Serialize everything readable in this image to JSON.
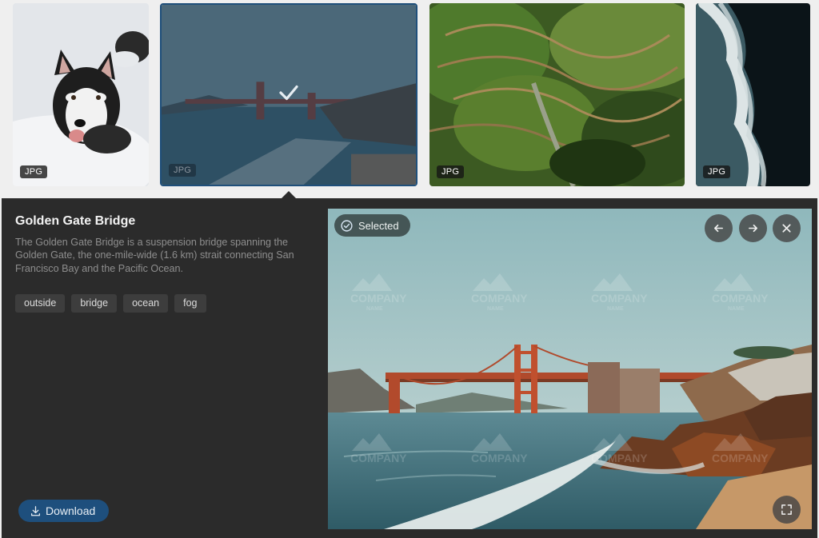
{
  "thumbnails": [
    {
      "badge": "JPG",
      "alt": "husky"
    },
    {
      "badge": "JPG",
      "alt": "golden-gate",
      "selected": true
    },
    {
      "badge": "JPG",
      "alt": "rice-terraces"
    },
    {
      "badge": "JPG",
      "alt": "ocean-waves"
    }
  ],
  "detail": {
    "title": "Golden Gate Bridge",
    "description": "The Golden Gate Bridge is a suspension bridge spanning the Golden Gate, the one-mile-wide (1.6 km) strait connecting San Francisco Bay and the Pacific Ocean.",
    "tags": [
      "outside",
      "bridge",
      "ocean",
      "fog"
    ],
    "download_label": "Download"
  },
  "preview": {
    "selected_label": "Selected",
    "watermark_line1": "COMPANY",
    "watermark_line2": "NAME"
  },
  "icons": {
    "check": "check-icon",
    "prev": "arrow-left-icon",
    "next": "arrow-right-icon",
    "close": "close-icon",
    "expand": "expand-icon",
    "download": "download-icon"
  },
  "colors": {
    "panel_bg": "#2b2b2b",
    "accent": "#1e4f7d",
    "strip_bg": "#efefef"
  }
}
